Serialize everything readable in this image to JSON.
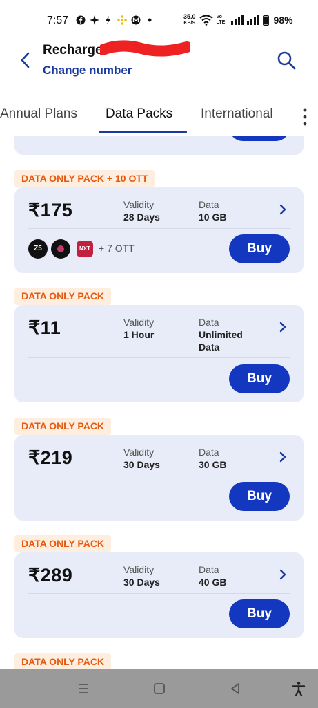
{
  "status": {
    "time": "7:57",
    "speed_value": "35.0",
    "speed_unit": "KB/S",
    "network": "Vo LTE",
    "battery": "98%"
  },
  "header": {
    "title": "Recharge",
    "change_number": "Change number"
  },
  "tabs": [
    {
      "label": "Annual Plans",
      "active": false
    },
    {
      "label": "Data Packs",
      "active": true
    },
    {
      "label": "International",
      "active": false
    }
  ],
  "plans": [
    {
      "tag": "DATA ONLY PACK + 10 OTT",
      "price": "₹175",
      "validity_label": "Validity",
      "validity": "28 Days",
      "data_label": "Data",
      "data": "10 GB",
      "ott_more": "+ 7 OTT",
      "buy": "Buy"
    },
    {
      "tag": "DATA ONLY PACK",
      "price": "₹11",
      "validity_label": "Validity",
      "validity": "1 Hour",
      "data_label": "Data",
      "data": "Unlimited Data",
      "buy": "Buy"
    },
    {
      "tag": "DATA ONLY PACK",
      "price": "₹219",
      "validity_label": "Validity",
      "validity": "30 Days",
      "data_label": "Data",
      "data": "30 GB",
      "buy": "Buy"
    },
    {
      "tag": "DATA ONLY PACK",
      "price": "₹289",
      "validity_label": "Validity",
      "validity": "30 Days",
      "data_label": "Data",
      "data": "40 GB",
      "buy": "Buy"
    },
    {
      "tag": "DATA ONLY PACK"
    }
  ],
  "ott_icons": [
    "zee5-icon",
    "sony-liv-icon",
    "sun-nxt-icon"
  ],
  "colors": {
    "accent": "#1437c0",
    "link": "#1a3aa0",
    "card_bg": "#e8ecf8",
    "tag_bg": "#fdeee0",
    "tag_text": "#e65a10"
  }
}
